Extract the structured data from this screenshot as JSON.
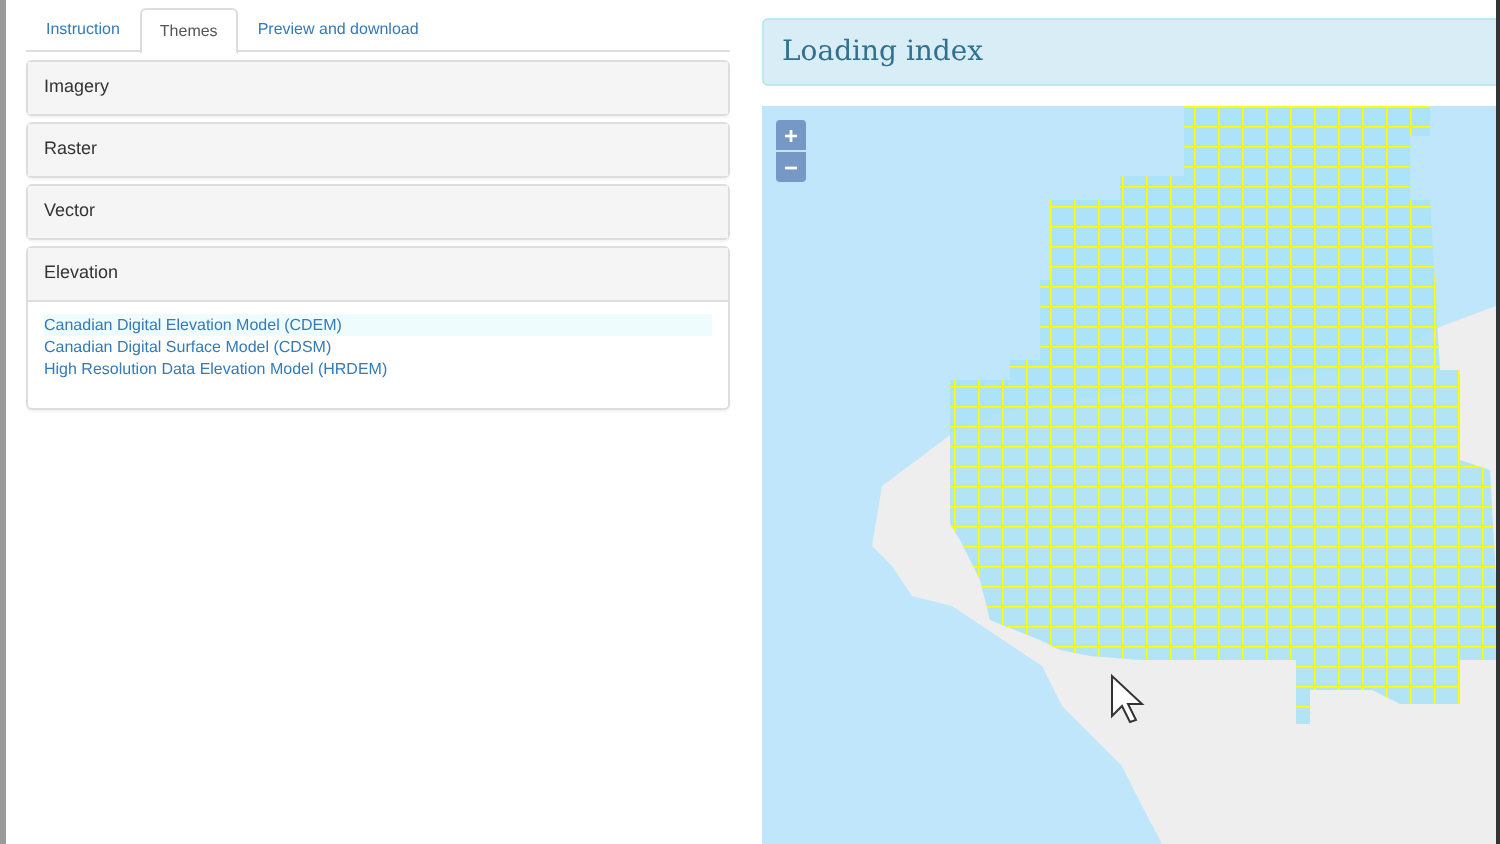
{
  "tabs": [
    {
      "label": "Instruction",
      "selected": false
    },
    {
      "label": "Themes",
      "selected": true
    },
    {
      "label": "Preview and download",
      "selected": false
    }
  ],
  "panels": [
    {
      "title": "Imagery",
      "expanded": false
    },
    {
      "title": "Raster",
      "expanded": false
    },
    {
      "title": "Vector",
      "expanded": false
    },
    {
      "title": "Elevation",
      "expanded": true,
      "items": [
        {
          "label": "Canadian Digital Elevation Model (CDEM)",
          "selected": true
        },
        {
          "label": "Canadian Digital Surface Model (CDSM)",
          "selected": false
        },
        {
          "label": "High Resolution Data Elevation Model (HRDEM)",
          "selected": false
        }
      ]
    }
  ],
  "status_header": "Loading index",
  "map": {
    "zoom_in": "+",
    "zoom_out": "−"
  }
}
